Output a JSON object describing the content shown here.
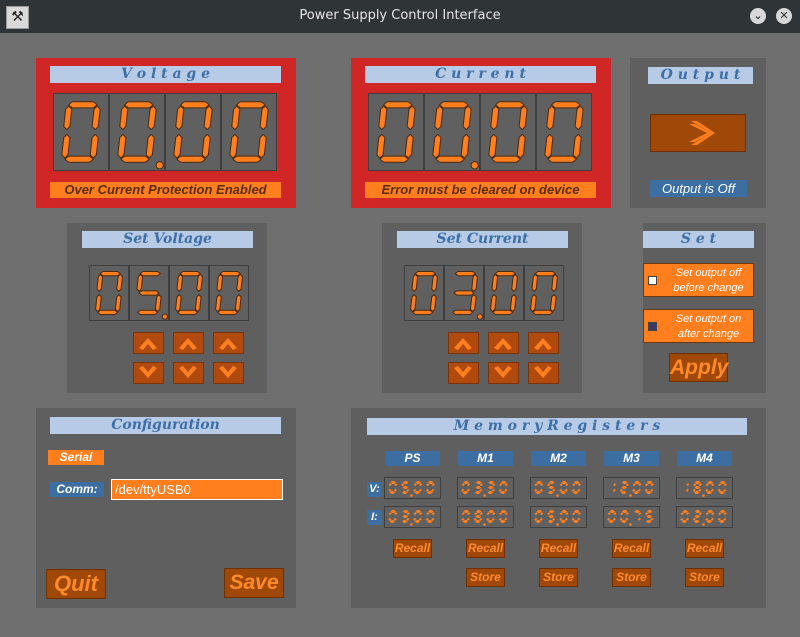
{
  "window": {
    "title": "Power Supply Control Interface",
    "app_icon": "x-logo-icon",
    "minimize_icon": "chevron-down-icon",
    "close_icon": "close-icon"
  },
  "voltage": {
    "header": "V o l t a g e",
    "display": "00.00",
    "status": "Over Current Protection Enabled"
  },
  "current": {
    "header": "C u r r e n t",
    "display": "00.00",
    "status": "Error must be cleared on device"
  },
  "output": {
    "header": "O u t p u t",
    "toggle_icon": "chevron-right-icon",
    "status": "Output is Off"
  },
  "set_voltage": {
    "header": "Set  Voltage",
    "display": "05.00"
  },
  "set_current": {
    "header": "Set  Current",
    "display": "03.00"
  },
  "set": {
    "header": "S  e  t",
    "option_off_line1": "Set output off",
    "option_off_line2": "before change",
    "option_on_line1": "Set output on",
    "option_on_line2": "after change",
    "apply_label": "Apply"
  },
  "configuration": {
    "header": "Configuration",
    "serial_label": "Serial",
    "comm_label": "Comm:",
    "comm_value": "/dev/ttyUSB0",
    "quit_label": "Quit",
    "save_label": "Save"
  },
  "memory": {
    "header": "M e m o r y    R e g i s t e r s",
    "v_label": "V:",
    "i_label": "I:",
    "recall_label": "Recall",
    "store_label": "Store",
    "registers": [
      {
        "name": "PS",
        "v": "05.00",
        "i": "03.00"
      },
      {
        "name": "M1",
        "v": "03.30",
        "i": "08.00"
      },
      {
        "name": "M2",
        "v": "05.00",
        "i": "05.00"
      },
      {
        "name": "M3",
        "v": "12.00",
        "i": "00.75"
      },
      {
        "name": "M4",
        "v": "18.00",
        "i": "02.00"
      }
    ]
  },
  "colors": {
    "accent": "#ff7f1f",
    "panel": "#5f5f5f",
    "alert_frame": "#d02626",
    "header_bg": "#b7cbe6",
    "label_blue": "#3c6ea1"
  }
}
